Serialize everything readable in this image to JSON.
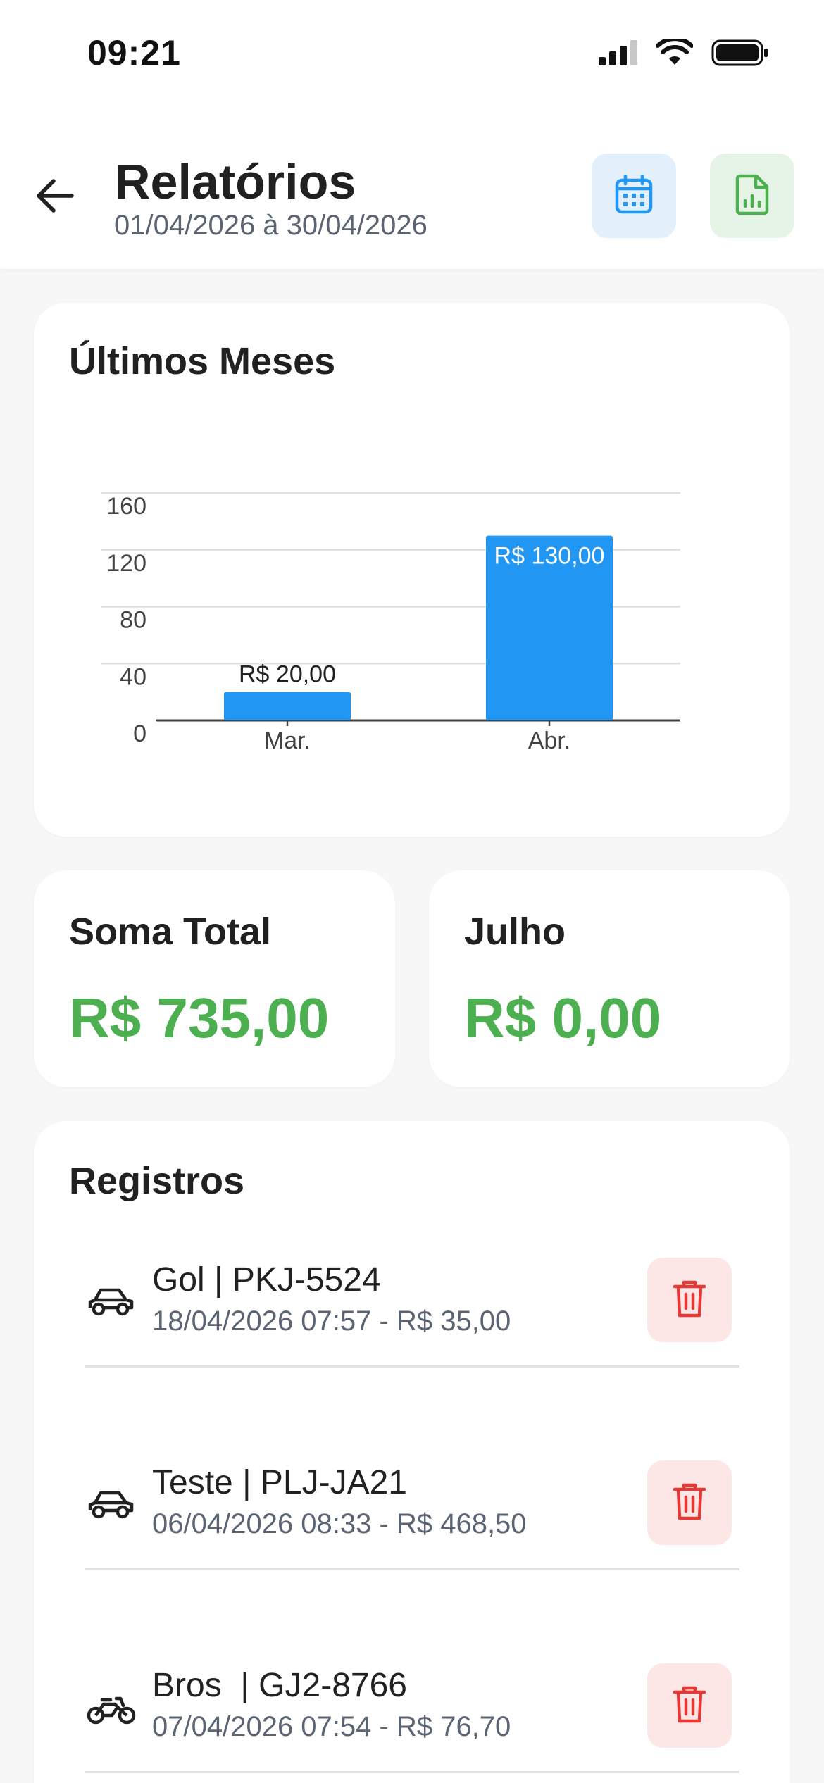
{
  "status_bar": {
    "time": "09:21",
    "icons": [
      "signal-icon",
      "wifi-icon",
      "battery-icon"
    ]
  },
  "header": {
    "title": "Relatórios",
    "date_range": "01/04/2026 à 30/04/2026",
    "back_icon": "arrow-left-icon",
    "calendar_icon": "calendar-icon",
    "export_icon": "spreadsheet-chart-icon"
  },
  "chart_card": {
    "title": "Últimos Meses"
  },
  "chart_data": {
    "type": "bar",
    "categories": [
      "Mar.",
      "Abr."
    ],
    "values": [
      20,
      130
    ],
    "data_labels": [
      "R$ 20,00",
      "R$ 130,00"
    ],
    "yticks": [
      "0",
      "40",
      "80",
      "120",
      "160"
    ],
    "ylim": [
      0,
      160
    ],
    "grid": true,
    "color": "#2196f3"
  },
  "summary": {
    "total_label": "Soma Total",
    "total_value": "R$ 735,00",
    "month_label": "Julho",
    "month_value": "R$ 0,00"
  },
  "records": {
    "title": "Registros",
    "items": [
      {
        "vehicle_icon": "car-icon",
        "title": "Gol | PKJ-5524",
        "subtitle": "18/04/2026 07:57 - R$ 35,00"
      },
      {
        "vehicle_icon": "car-icon",
        "title": "Teste | PLJ-JA21",
        "subtitle": "06/04/2026 08:33 - R$ 468,50"
      },
      {
        "vehicle_icon": "motorcycle-icon",
        "title": "Bros  | GJ2-8766",
        "subtitle": "07/04/2026 07:54 - R$ 76,70"
      }
    ]
  },
  "colors": {
    "accent_blue": "#2196f3",
    "accent_green": "#4caf50",
    "danger_red": "#e53935"
  }
}
